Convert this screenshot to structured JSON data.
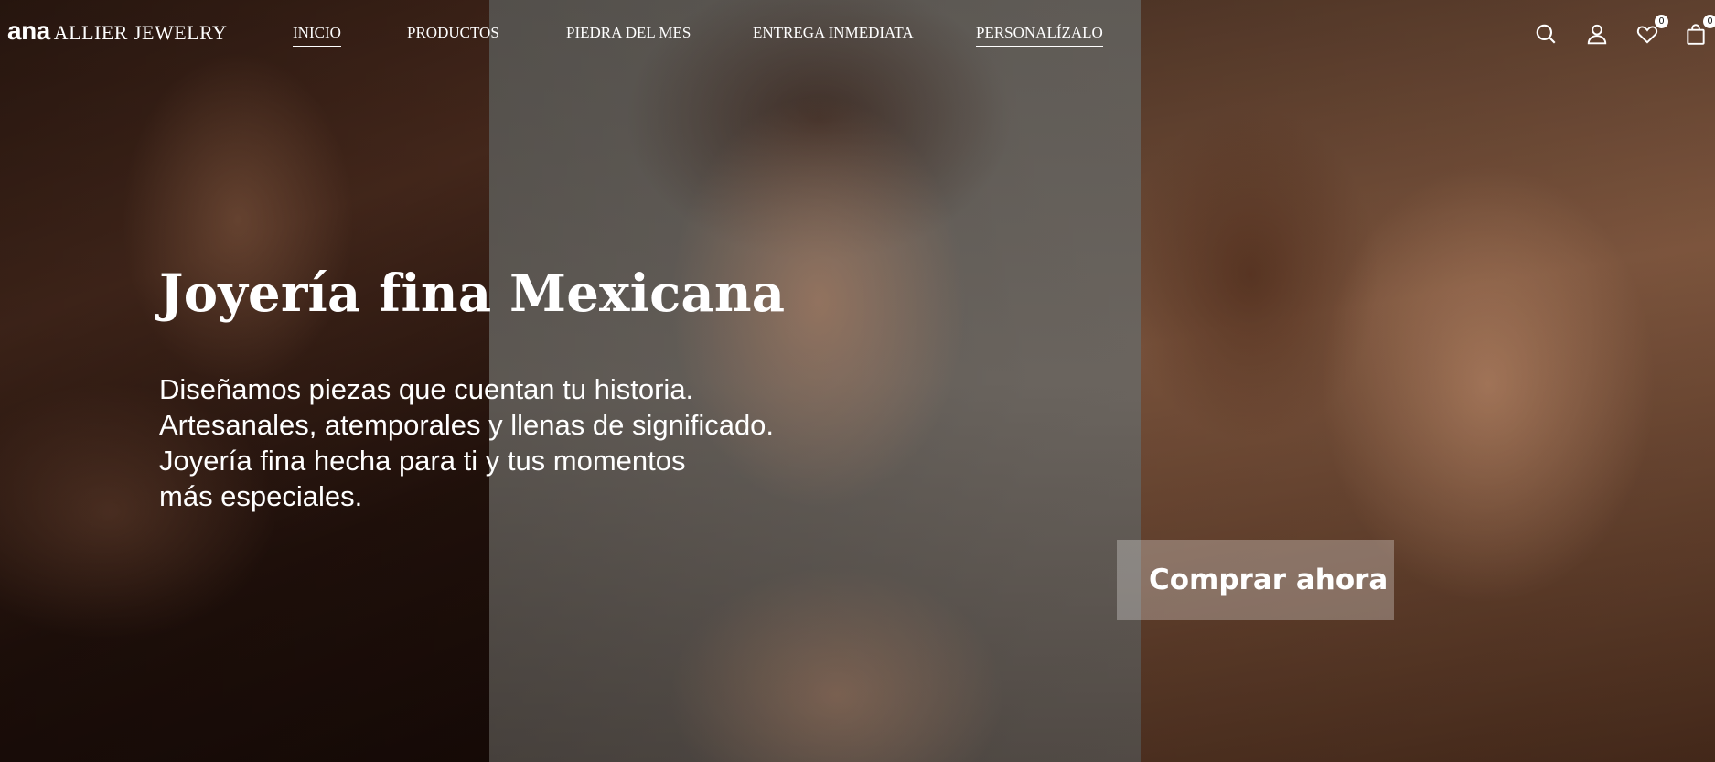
{
  "brand": {
    "logo_ana": "ana",
    "logo_rest": "ALLIER JEWELRY"
  },
  "nav": {
    "items": [
      {
        "label": "INICIO",
        "underlined": true
      },
      {
        "label": "PRODUCTOS",
        "underlined": false
      },
      {
        "label": "PIEDRA DEL MES",
        "underlined": false
      },
      {
        "label": "ENTREGA INMEDIATA",
        "underlined": false
      },
      {
        "label": "PERSONALÍZALO",
        "underlined": true
      }
    ]
  },
  "header_icons": {
    "search": "search-icon",
    "account": "user-icon",
    "wishlist": "heart-icon",
    "wishlist_count": "0",
    "cart": "bag-icon",
    "cart_count": "0"
  },
  "hero": {
    "headline": "Joyería fina Mexicana",
    "description_lines": [
      "Diseñamos piezas que cuentan tu historia.",
      "Artesanales, atemporales y llenas de significado.",
      "Joyería fina hecha para ti y tus momentos",
      "más especiales."
    ],
    "cta_label": "Comprar ahora"
  },
  "colors": {
    "text": "#ffffff",
    "cta_background": "rgba(255,255,255,0.28)"
  }
}
